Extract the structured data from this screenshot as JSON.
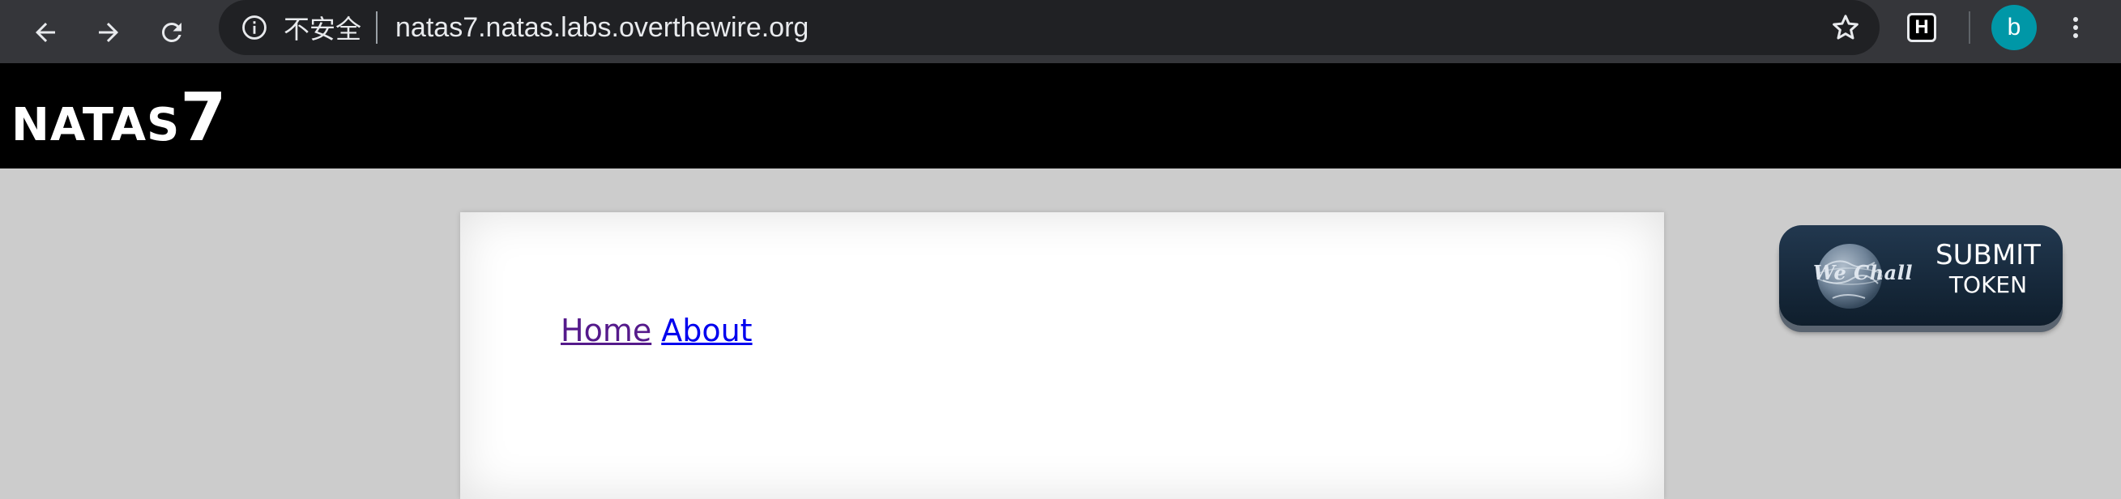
{
  "browser": {
    "security_label": "不安全",
    "url": "natas7.natas.labs.overthewire.org",
    "profile_initial": "b",
    "extension_label": "H",
    "icons": {
      "back": "arrow-left",
      "forward": "arrow-right",
      "reload": "refresh",
      "info": "info-circle",
      "bookmark": "star-outline",
      "menu": "vertical-dots"
    },
    "colors": {
      "toolbar": "#35363a",
      "omnibox": "#202124",
      "avatar": "#0097a7"
    }
  },
  "header": {
    "title_prefix": "NATAS",
    "title_level": "7"
  },
  "content": {
    "links": {
      "home": "Home",
      "about": "About"
    }
  },
  "wechall": {
    "logo_text": "We Chall",
    "action_line1": "SUBMIT",
    "action_line2": "TOKEN"
  }
}
